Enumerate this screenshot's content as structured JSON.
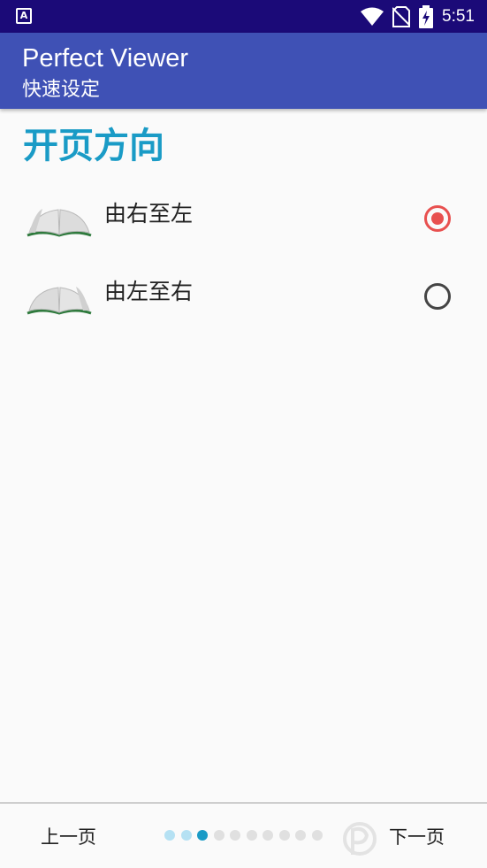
{
  "status_bar": {
    "notification_icon": "a-badge-icon",
    "time": "5:51",
    "icons": [
      "wifi-icon",
      "no-sim-icon",
      "battery-charging-icon"
    ]
  },
  "app_bar": {
    "title": "Perfect Viewer",
    "subtitle": "快速设定"
  },
  "section": {
    "heading": "开页方向",
    "options": [
      {
        "label": "由右至左",
        "icon": "book-icon",
        "selected": true
      },
      {
        "label": "由左至右",
        "icon": "book-icon",
        "selected": false
      }
    ]
  },
  "bottom_nav": {
    "prev_label": "上一页",
    "next_label": "下一页",
    "pages_total": 10,
    "current_page": 3
  },
  "colors": {
    "status_bar": "#1b0a78",
    "app_bar": "#3f51b5",
    "heading": "#1a9bc6",
    "radio_checked": "#e8504f"
  }
}
